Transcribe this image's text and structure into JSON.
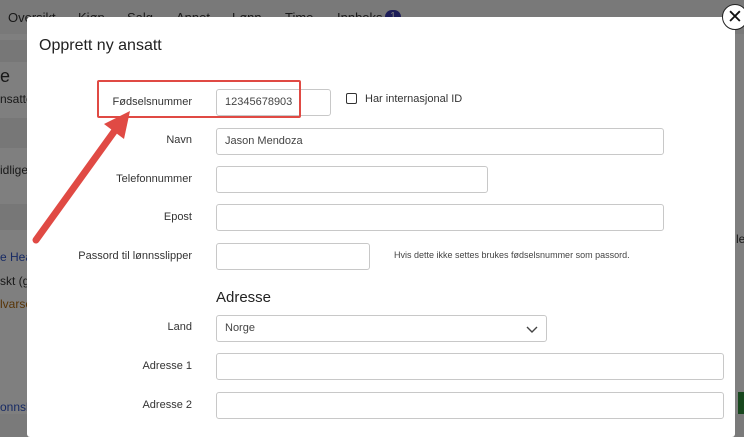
{
  "background": {
    "nav": [
      "Oversikt",
      "Kjøp",
      "Salg",
      "Annet",
      "Lønn",
      "Time",
      "Innboks"
    ],
    "inbox_badge": "1",
    "fragments": [
      "e",
      "nsatte",
      "idlige",
      "e Hea",
      "skt (gr",
      "lvarse",
      "onnsl",
      "le"
    ]
  },
  "modal": {
    "title": "Opprett ny ansatt",
    "close_symbol": "✕",
    "fields": {
      "fnr_label": "Fødselsnummer",
      "fnr_value": "12345678903",
      "intl_id_label": "Har internasjonal ID",
      "name_label": "Navn",
      "name_value": "Jason Mendoza",
      "phone_label": "Telefonnummer",
      "phone_value": "",
      "email_label": "Epost",
      "email_value": "",
      "password_label": "Passord til lønnsslipper",
      "password_value": "",
      "password_hint": "Hvis dette ikke settes brukes fødselsnummer som passord."
    },
    "address": {
      "heading": "Adresse",
      "country_label": "Land",
      "country_value": "Norge",
      "address1_label": "Adresse 1",
      "address1_value": "",
      "address2_label": "Adresse 2",
      "address2_value": ""
    }
  },
  "annotation": {
    "color": "#e04a44"
  }
}
